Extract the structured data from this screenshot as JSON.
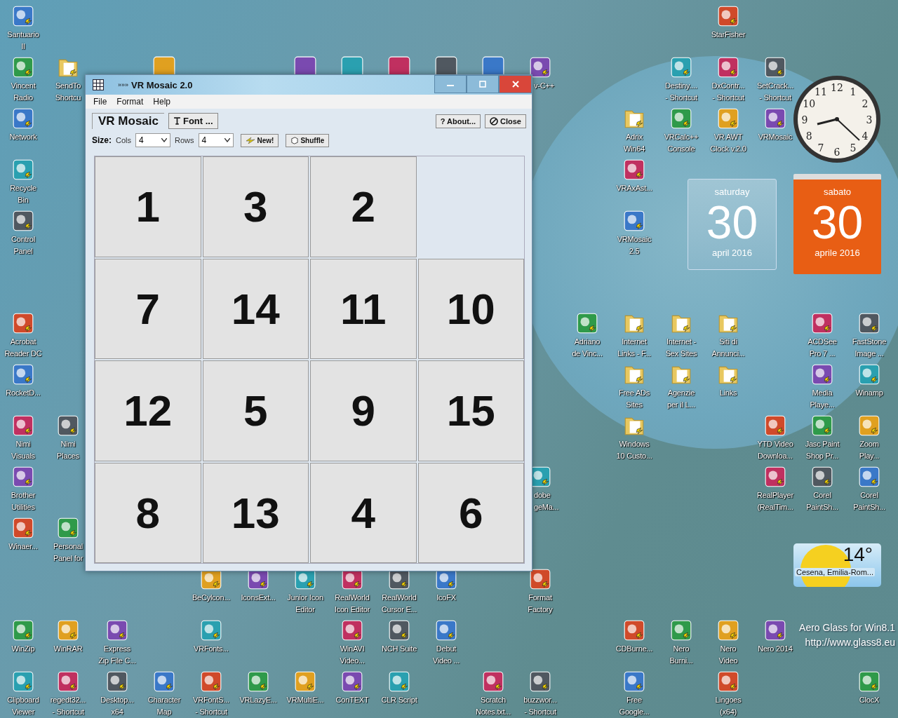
{
  "desktop": {
    "icons": [
      {
        "kind": "app",
        "lines": [
          "Santuario",
          "II"
        ]
      },
      {
        "kind": "app",
        "lines": [
          "StarFisher"
        ]
      },
      {
        "kind": "app",
        "lines": [
          "Vincent",
          "Radio"
        ]
      },
      {
        "kind": "folder",
        "lines": [
          "SendTo",
          "Shortcu"
        ]
      },
      {
        "kind": "partial",
        "lines": [
          "v-C++"
        ]
      },
      {
        "kind": "app",
        "lines": [
          "Destiny....",
          "- Shortcut"
        ]
      },
      {
        "kind": "app",
        "lines": [
          "DxContr...",
          "- Shortcut"
        ]
      },
      {
        "kind": "app",
        "lines": [
          "SetCrack...",
          "- Shortcut"
        ]
      },
      {
        "kind": "app",
        "lines": [
          "Network"
        ]
      },
      {
        "kind": "folder",
        "lines": [
          "Adrix",
          "Win64"
        ]
      },
      {
        "kind": "app",
        "lines": [
          "VRCalc++",
          "Console"
        ]
      },
      {
        "kind": "app",
        "lines": [
          "VR AWT",
          "Clock v.2.0"
        ]
      },
      {
        "kind": "app",
        "lines": [
          "VRMosaic"
        ]
      },
      {
        "kind": "app",
        "lines": [
          "Recycle",
          "Bin"
        ]
      },
      {
        "kind": "app",
        "lines": [
          "VRAxAst..."
        ]
      },
      {
        "kind": "app",
        "lines": [
          "Control",
          "Panel"
        ]
      },
      {
        "kind": "app",
        "lines": [
          "VRMosaic",
          "2.5"
        ]
      },
      {
        "kind": "app",
        "lines": [
          "Acrobat",
          "Reader DC"
        ]
      },
      {
        "kind": "app",
        "lines": [
          "Adriano",
          "de Vinc..."
        ]
      },
      {
        "kind": "folder",
        "lines": [
          "Internet",
          "Links - F..."
        ]
      },
      {
        "kind": "folder",
        "lines": [
          "Internet -",
          "Sex Sites"
        ]
      },
      {
        "kind": "folder",
        "lines": [
          "Siti di",
          "Annunci..."
        ]
      },
      {
        "kind": "app",
        "lines": [
          "ACDSee",
          "Pro 7 ..."
        ]
      },
      {
        "kind": "app",
        "lines": [
          "FastStone",
          "Image ..."
        ]
      },
      {
        "kind": "app",
        "lines": [
          "RocketD..."
        ]
      },
      {
        "kind": "folder",
        "lines": [
          "Free ADs",
          "Sites"
        ]
      },
      {
        "kind": "folder",
        "lines": [
          "Agenzie",
          "per il L..."
        ]
      },
      {
        "kind": "folder",
        "lines": [
          "Links"
        ]
      },
      {
        "kind": "app",
        "lines": [
          "Media",
          "Playe..."
        ]
      },
      {
        "kind": "app",
        "lines": [
          "Winamp"
        ]
      },
      {
        "kind": "app",
        "lines": [
          "Nimi",
          "Visuals"
        ]
      },
      {
        "kind": "app",
        "lines": [
          "Nimi",
          "Places"
        ]
      },
      {
        "kind": "folder",
        "lines": [
          "Windows",
          "10 Custo..."
        ]
      },
      {
        "kind": "app",
        "lines": [
          "YTD Video",
          "Downloa..."
        ]
      },
      {
        "kind": "app",
        "lines": [
          "Jasc Paint",
          "Shop Pr..."
        ]
      },
      {
        "kind": "app",
        "lines": [
          "Zoom",
          "Play..."
        ]
      },
      {
        "kind": "app",
        "lines": [
          "Brother",
          "Utilities"
        ]
      },
      {
        "kind": "partial",
        "lines": [
          "dobe",
          "geMa..."
        ]
      },
      {
        "kind": "app",
        "lines": [
          "RealPlayer",
          "(RealTim..."
        ]
      },
      {
        "kind": "app",
        "lines": [
          "Corel",
          "PaintSh..."
        ]
      },
      {
        "kind": "app",
        "lines": [
          "Corel",
          "PaintSh..."
        ]
      },
      {
        "kind": "app",
        "lines": [
          "Winaer..."
        ]
      },
      {
        "kind": "app",
        "lines": [
          "Personal",
          "Panel for"
        ]
      },
      {
        "kind": "app",
        "lines": [
          "BeCylcon..."
        ]
      },
      {
        "kind": "app",
        "lines": [
          "IconsExt..."
        ]
      },
      {
        "kind": "app",
        "lines": [
          "Junior Icon",
          "Editor"
        ]
      },
      {
        "kind": "app",
        "lines": [
          "RealWorld",
          "Icon Editor"
        ]
      },
      {
        "kind": "app",
        "lines": [
          "RealWorld",
          "Cursor E..."
        ]
      },
      {
        "kind": "app",
        "lines": [
          "IcoFX"
        ]
      },
      {
        "kind": "app",
        "lines": [
          "Format",
          "Factory"
        ]
      },
      {
        "kind": "app",
        "lines": [
          "WinZip"
        ]
      },
      {
        "kind": "app",
        "lines": [
          "WinRAR"
        ]
      },
      {
        "kind": "app",
        "lines": [
          "Express",
          "Zip File C..."
        ]
      },
      {
        "kind": "app",
        "lines": [
          "VRFonts..."
        ]
      },
      {
        "kind": "app",
        "lines": [
          "WinAVI",
          "Video..."
        ]
      },
      {
        "kind": "app",
        "lines": [
          "NCH Suite"
        ]
      },
      {
        "kind": "app",
        "lines": [
          "Debut",
          "Video ..."
        ]
      },
      {
        "kind": "app",
        "lines": [
          "CDBurne..."
        ]
      },
      {
        "kind": "app",
        "lines": [
          "Nero",
          "Burni..."
        ]
      },
      {
        "kind": "app",
        "lines": [
          "Nero",
          "Video"
        ]
      },
      {
        "kind": "app",
        "lines": [
          "Nero 2014"
        ]
      },
      {
        "kind": "app",
        "lines": [
          "Clipboard",
          "Viewer"
        ]
      },
      {
        "kind": "app",
        "lines": [
          "regedt32...",
          "- Shortcut"
        ]
      },
      {
        "kind": "app",
        "lines": [
          "Desktop...",
          "x64"
        ]
      },
      {
        "kind": "app",
        "lines": [
          "Character",
          "Map"
        ]
      },
      {
        "kind": "app",
        "lines": [
          "VRFontS...",
          "- Shortcut"
        ]
      },
      {
        "kind": "app",
        "lines": [
          "VRLazyE..."
        ]
      },
      {
        "kind": "app",
        "lines": [
          "VRMultiE..."
        ]
      },
      {
        "kind": "app",
        "lines": [
          "ConTEXT"
        ]
      },
      {
        "kind": "app",
        "lines": [
          "CLR Script"
        ]
      },
      {
        "kind": "app",
        "lines": [
          "Scratch",
          "Notes.txt..."
        ]
      },
      {
        "kind": "app",
        "lines": [
          "buzzwor...",
          "- Shortcut"
        ]
      },
      {
        "kind": "app",
        "lines": [
          "Free",
          "Google..."
        ]
      },
      {
        "kind": "app",
        "lines": [
          "Lingoes",
          "(x64)"
        ]
      },
      {
        "kind": "app",
        "lines": [
          "ClocX"
        ]
      }
    ],
    "clock": {
      "numerals": [
        "11",
        "12",
        "1",
        "10",
        "2",
        "9",
        "3",
        "8",
        "4",
        "7",
        "6",
        "5"
      ]
    },
    "calendar_glass": {
      "weekday": "saturday",
      "day": "30",
      "month": "april 2016"
    },
    "calendar_orange": {
      "weekday": "sabato",
      "day": "30",
      "month": "aprile 2016"
    },
    "weather": {
      "temperature": "14°",
      "place": "Cesena, Emilia-Rom..."
    },
    "glass_notice": {
      "line_1": "Aero Glass for Win8.1",
      "line_2": "http://www.glass8.eu"
    }
  },
  "window": {
    "title_prefix": "»»»",
    "title": "VR Mosaic 2.0",
    "menu": [
      "File",
      "Format",
      "Help"
    ],
    "heading": "VR Mosaic",
    "font_button": "Font ...",
    "about_button": "? About...",
    "close_button": "Close",
    "size_label": "Size:",
    "cols_label": "Cols",
    "cols_value": "4",
    "rows_label": "Rows",
    "rows_value": "4",
    "new_button": "New!",
    "shuffle_button": "Shuffle",
    "tiles": [
      {
        "kind": "number",
        "label": "1"
      },
      {
        "kind": "number",
        "label": "3"
      },
      {
        "kind": "number",
        "label": "2"
      },
      {
        "kind": "blank"
      },
      {
        "kind": "number",
        "label": "7"
      },
      {
        "kind": "number",
        "label": "14"
      },
      {
        "kind": "number",
        "label": "11"
      },
      {
        "kind": "number",
        "label": "10"
      },
      {
        "kind": "number",
        "label": "12"
      },
      {
        "kind": "number",
        "label": "5"
      },
      {
        "kind": "number",
        "label": "9"
      },
      {
        "kind": "number",
        "label": "15"
      },
      {
        "kind": "number",
        "label": "8"
      },
      {
        "kind": "number",
        "label": "13"
      },
      {
        "kind": "number",
        "label": "4"
      },
      {
        "kind": "number",
        "label": "6"
      }
    ]
  }
}
